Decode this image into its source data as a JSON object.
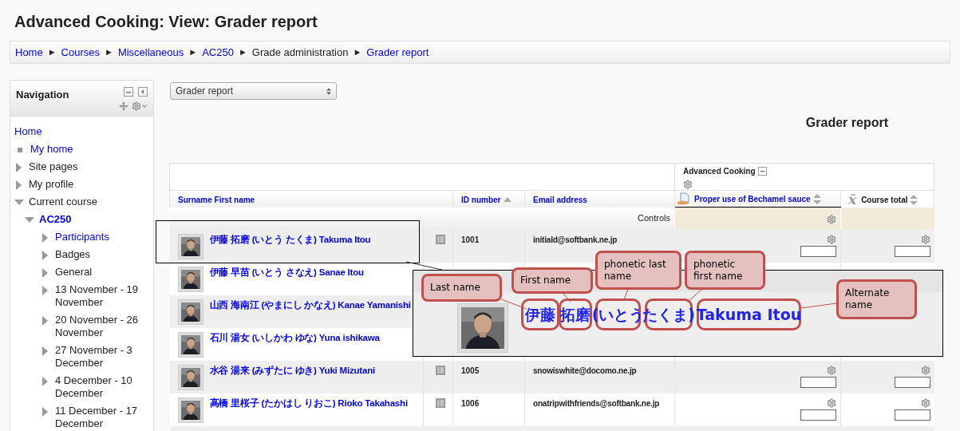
{
  "page_title": "Advanced Cooking: View: Grader report",
  "breadcrumb": [
    {
      "label": "Home",
      "link": true
    },
    {
      "label": "Courses",
      "link": true
    },
    {
      "label": "Miscellaneous",
      "link": true
    },
    {
      "label": "AC250",
      "link": true
    },
    {
      "label": "Grade administration",
      "link": false
    },
    {
      "label": "Grader report",
      "link": true
    }
  ],
  "breadcrumb_separator": "►",
  "navigation": {
    "title": "Navigation",
    "items": [
      {
        "label": "Home",
        "kind": "plain",
        "link": true
      },
      {
        "label": "My home",
        "kind": "bullet",
        "link": true
      },
      {
        "label": "Site pages",
        "kind": "branch",
        "link": false,
        "expanded": false
      },
      {
        "label": "My profile",
        "kind": "branch",
        "link": false,
        "expanded": false
      },
      {
        "label": "Current course",
        "kind": "branch",
        "link": false,
        "expanded": true,
        "children": [
          {
            "label": "AC250",
            "kind": "branch",
            "link": true,
            "expanded": true,
            "current": true,
            "children": [
              {
                "label": "Participants",
                "kind": "branch",
                "link": true,
                "expanded": false
              },
              {
                "label": "Badges",
                "kind": "branch",
                "link": false,
                "expanded": false
              },
              {
                "label": "General",
                "kind": "branch",
                "link": false,
                "expanded": false
              },
              {
                "label": "13 November - 19 November",
                "kind": "branch",
                "link": false,
                "expanded": false
              },
              {
                "label": "20 November - 26 November",
                "kind": "branch",
                "link": false,
                "expanded": false
              },
              {
                "label": "27 November - 3 December",
                "kind": "branch",
                "link": false,
                "expanded": false
              },
              {
                "label": "4 December - 10 December",
                "kind": "branch",
                "link": false,
                "expanded": false
              },
              {
                "label": "11 December - 17 December",
                "kind": "branch",
                "link": false,
                "expanded": false
              }
            ]
          }
        ]
      }
    ]
  },
  "report_select": {
    "value": "Grader report"
  },
  "heading": "Grader report",
  "table": {
    "category": "Advanced Cooking",
    "columns": [
      {
        "label": "Surname First name"
      },
      {
        "label": "ID number",
        "sorted_ascending": true
      },
      {
        "label": "Email address"
      },
      {
        "label": "Proper use of Bechamel sauce",
        "sortable": true
      },
      {
        "label": "Course total",
        "sortable": true,
        "symbol": "x̄"
      }
    ],
    "controls_label": "Controls",
    "rows": [
      {
        "name": "伊藤 拓磨 (いとう たくま) Takuma Itou",
        "id": "1001",
        "email": "initiald@softbank.ne.jp"
      },
      {
        "name": "伊藤 早苗 (いとう さなえ) Sanae Itou"
      },
      {
        "name": "山西 海南江 (やまにし かなえ) Kanae Yamanishi"
      },
      {
        "name": "石川 湯女 (いしかわ ゆな) Yuna ishikawa"
      },
      {
        "name": "水谷 湯来 (みずたに ゆき) Yuki Mizutani",
        "id": "1005",
        "email": "snowiswhite@docomo.ne.jp"
      },
      {
        "name": "高橋 里桜子 (たかはし りおこ) Rioko Takahashi",
        "id": "1006",
        "email": "onatripwithfriends@softbank.ne.jp"
      }
    ]
  },
  "callout": {
    "parts": [
      "伊藤",
      "拓磨",
      "(いとう",
      "たくま)",
      "Takuma Itou"
    ],
    "labels": [
      "Last name",
      "First name",
      "phonetic last name",
      "phonetic first name",
      "Alternate name"
    ]
  }
}
